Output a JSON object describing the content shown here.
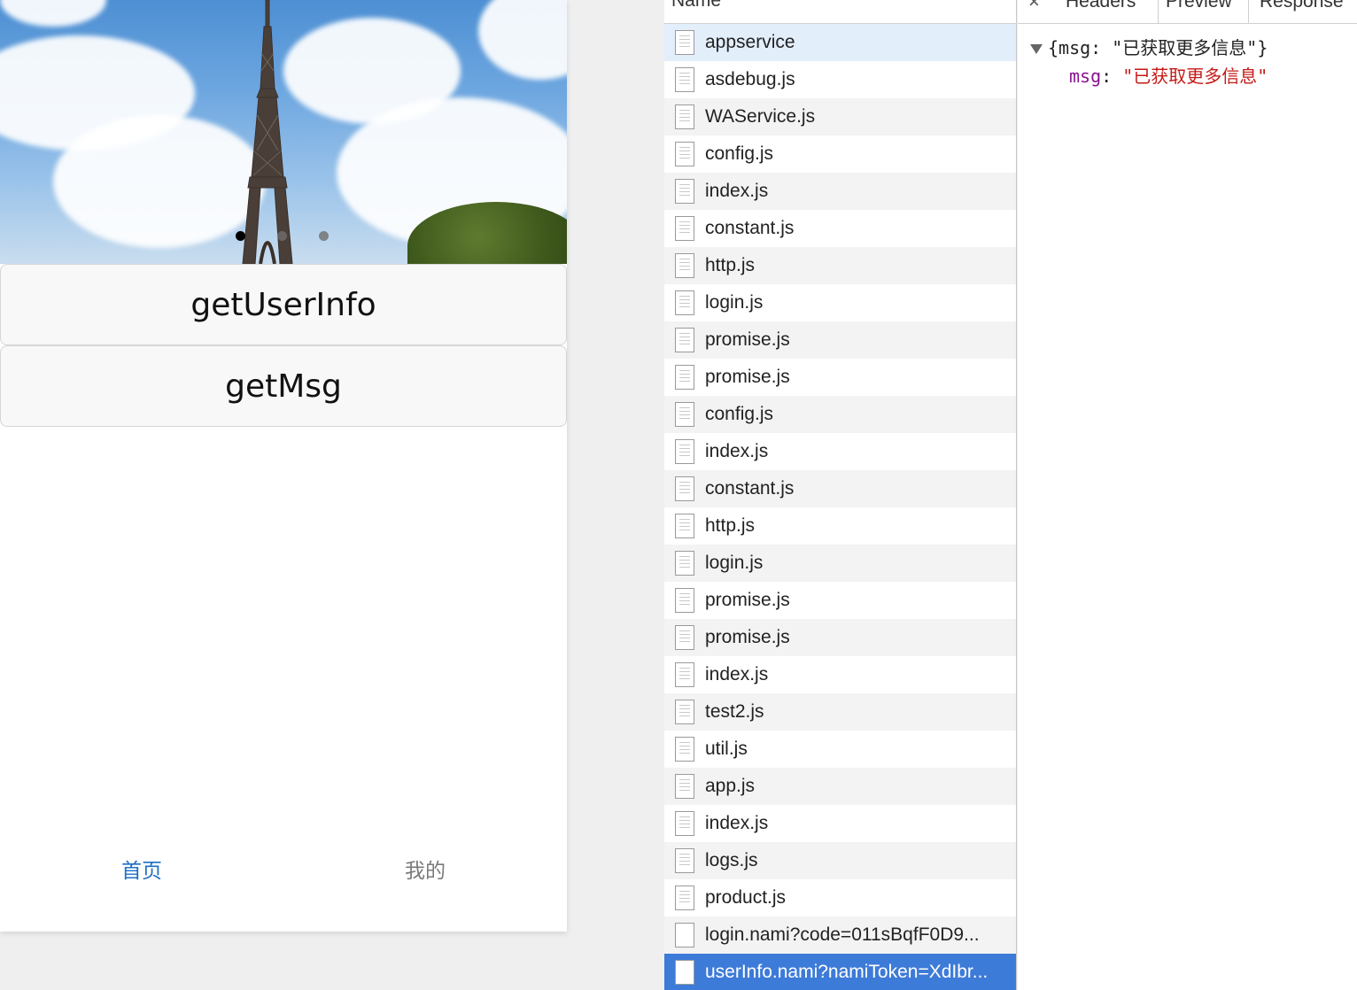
{
  "phone": {
    "buttons": {
      "get_user_info": "getUserInfo",
      "get_msg": "getMsg"
    },
    "tabs": [
      {
        "label": "首页",
        "active": true
      },
      {
        "label": "我的",
        "active": false
      }
    ],
    "carousel": {
      "dots": 3,
      "active_index": 0
    },
    "colors": {
      "tab_active": "#1e6fc4",
      "tab_inactive": "#7a7a7a"
    }
  },
  "network": {
    "column_header": "Name",
    "requests": [
      {
        "name": "appservice",
        "icon": "doc-icon"
      },
      {
        "name": "asdebug.js",
        "icon": "doc-icon"
      },
      {
        "name": "WAService.js",
        "icon": "doc-icon"
      },
      {
        "name": "config.js",
        "icon": "doc-icon"
      },
      {
        "name": "index.js",
        "icon": "doc-icon"
      },
      {
        "name": "constant.js",
        "icon": "doc-icon"
      },
      {
        "name": "http.js",
        "icon": "doc-icon"
      },
      {
        "name": "login.js",
        "icon": "doc-icon"
      },
      {
        "name": "promise.js",
        "icon": "doc-icon"
      },
      {
        "name": "promise.js",
        "icon": "doc-icon"
      },
      {
        "name": "config.js",
        "icon": "doc-icon"
      },
      {
        "name": "index.js",
        "icon": "doc-icon"
      },
      {
        "name": "constant.js",
        "icon": "doc-icon"
      },
      {
        "name": "http.js",
        "icon": "doc-icon"
      },
      {
        "name": "login.js",
        "icon": "doc-icon"
      },
      {
        "name": "promise.js",
        "icon": "doc-icon"
      },
      {
        "name": "promise.js",
        "icon": "doc-icon"
      },
      {
        "name": "index.js",
        "icon": "doc-icon"
      },
      {
        "name": "test2.js",
        "icon": "doc-icon"
      },
      {
        "name": "util.js",
        "icon": "doc-icon"
      },
      {
        "name": "app.js",
        "icon": "doc-icon"
      },
      {
        "name": "index.js",
        "icon": "doc-icon"
      },
      {
        "name": "logs.js",
        "icon": "doc-icon"
      },
      {
        "name": "product.js",
        "icon": "doc-icon"
      },
      {
        "name": "login.nami?code=011sBqfF0D9...",
        "icon": "blank-file-icon"
      },
      {
        "name": "userInfo.nami?namiToken=XdIbr...",
        "icon": "blank-file-icon",
        "selected": true
      }
    ],
    "colors": {
      "selected_row": "#3d7bd8",
      "hover_row": "#e3eefb"
    }
  },
  "detail": {
    "close": "×",
    "tabs": [
      "Headers",
      "Preview",
      "Response"
    ],
    "preview": {
      "summary": "{msg: \"已获取更多信息\"}",
      "key": "msg",
      "separator": ": ",
      "value": "\"已获取更多信息\""
    },
    "colors": {
      "json_key": "#881391",
      "json_string": "#c41a16"
    }
  }
}
